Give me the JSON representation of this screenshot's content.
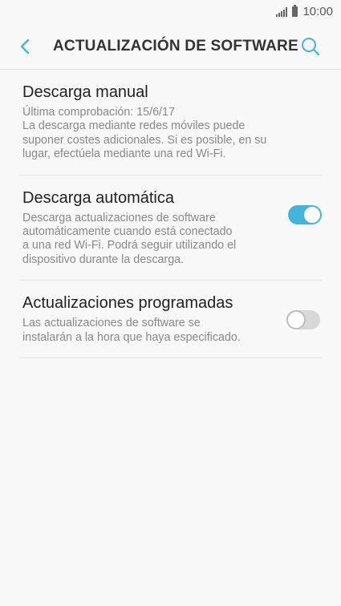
{
  "status_bar": {
    "time": "10:00"
  },
  "header": {
    "title": "ACTUALIZACIÓN DE SOFTWARE"
  },
  "items": [
    {
      "title": "Descarga manual",
      "description_lines": [
        "Última comprobación: 15/6/17",
        "La descarga mediante redes móviles puede",
        "suponer costes adicionales. Si es posible, en su",
        "lugar, efectúela mediante una red Wi-Fi."
      ]
    },
    {
      "title": "Descarga automática",
      "description_lines": [
        "Descarga actualizaciones de software",
        "automáticamente cuando está conectado",
        "a una red Wi-Fi. Podrá seguir utilizando el",
        "dispositivo durante la descarga."
      ],
      "toggle": "on"
    },
    {
      "title": "Actualizaciones programadas",
      "description_lines": [
        "Las actualizaciones de software se",
        "instalarán a la hora que haya especificado."
      ],
      "toggle": "off"
    }
  ],
  "colors": {
    "accent": "#42b4db",
    "background": "#f8f8f8",
    "toggle_off": "#d8d8d8"
  },
  "icons": [
    "signal-icon",
    "battery-icon",
    "back-arrow-icon",
    "search-icon"
  ]
}
